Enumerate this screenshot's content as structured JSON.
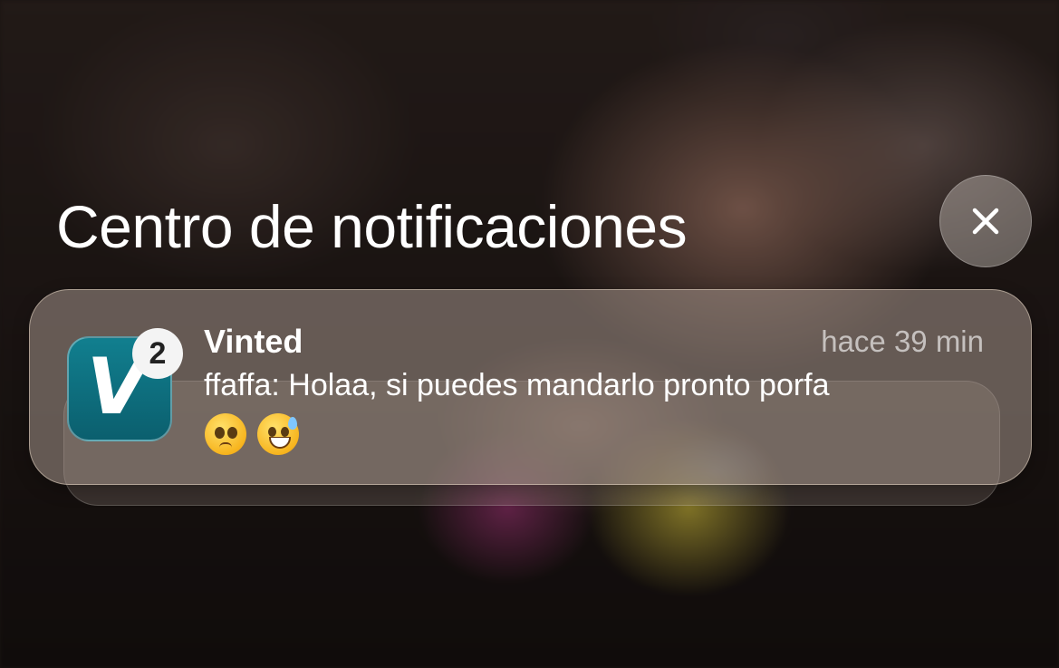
{
  "header": {
    "title": "Centro de notificaciones"
  },
  "close_button": {
    "icon": "close-icon"
  },
  "notification": {
    "app_name": "Vinted",
    "app_icon": "vinted-app-icon",
    "app_icon_letter": "V",
    "badge_count": "2",
    "time": "hace 39 min",
    "message": "ffaffa: Holaa, si puedes mandarlo pronto porfa",
    "emojis": [
      "pleading-face-emoji",
      "grinning-sweat-emoji"
    ],
    "accent_color": "#0e7080"
  }
}
